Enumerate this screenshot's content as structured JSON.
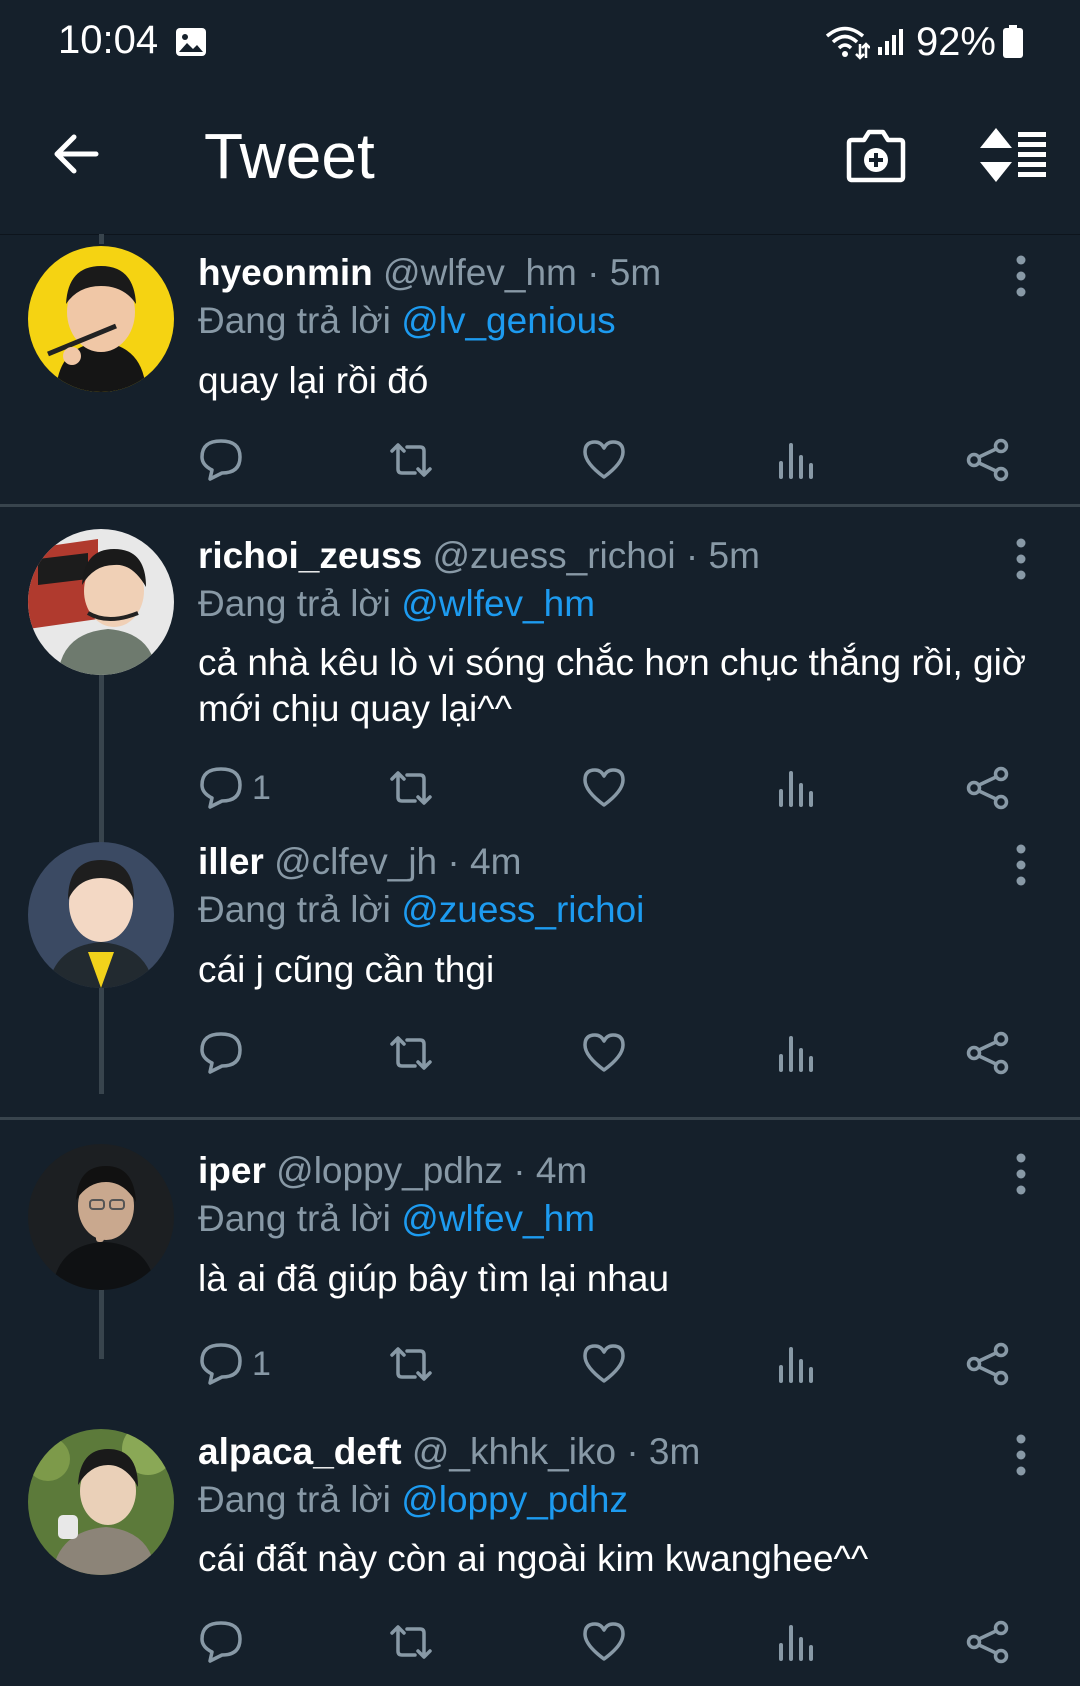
{
  "status_bar": {
    "time": "10:04",
    "battery": "92%",
    "icons": [
      "gallery-icon",
      "wifi-icon",
      "signal-icon",
      "battery-icon"
    ]
  },
  "app_bar": {
    "title": "Tweet",
    "icons": [
      "back-arrow-icon",
      "add-photo-icon",
      "sort-icon"
    ]
  },
  "colors": {
    "background": "#15202b",
    "divider": "#38444d",
    "secondary_text": "#8899a6",
    "mention_link": "#1d9bf0",
    "primary_text": "#ffffff"
  },
  "tweets": [
    {
      "name": "hyeonmin",
      "meta": "@wlfev_hm · 5m",
      "reply_prefix": "Đang trả lời",
      "reply_to": "@lv_genious",
      "text": "quay lại rồi đó",
      "reply_count": "",
      "avatar_bg": "#f5d312"
    },
    {
      "name": "richoi_zeuss",
      "meta": "@zuess_richoi · 5m",
      "reply_prefix": "Đang trả lời",
      "reply_to": "@wlfev_hm",
      "text": "cả nhà kêu lò vi sóng chắc hơn chục thắng rồi, giờ mới chịu quay lại^^",
      "reply_count": "1",
      "avatar_bg": "#b03a2e"
    },
    {
      "name": "iller",
      "meta": "@clfev_jh · 4m",
      "reply_prefix": "Đang trả lời",
      "reply_to": "@zuess_richoi",
      "text": "cái j cũng cần thgi",
      "reply_count": "",
      "avatar_bg": "#3b4a63"
    },
    {
      "name": "iper",
      "meta": "@loppy_pdhz · 4m",
      "reply_prefix": "Đang trả lời",
      "reply_to": "@wlfev_hm",
      "text": "là ai đã giúp bây tìm lại nhau",
      "reply_count": "1",
      "avatar_bg": "#1c1f22"
    },
    {
      "name": "alpaca_deft",
      "meta": "@_khhk_iko · 3m",
      "reply_prefix": "Đang trả lời",
      "reply_to": "@loppy_pdhz",
      "text": "cái đất này còn ai ngoài kim kwanghee^^",
      "reply_count": "",
      "avatar_bg": "#5c7a3a"
    }
  ]
}
